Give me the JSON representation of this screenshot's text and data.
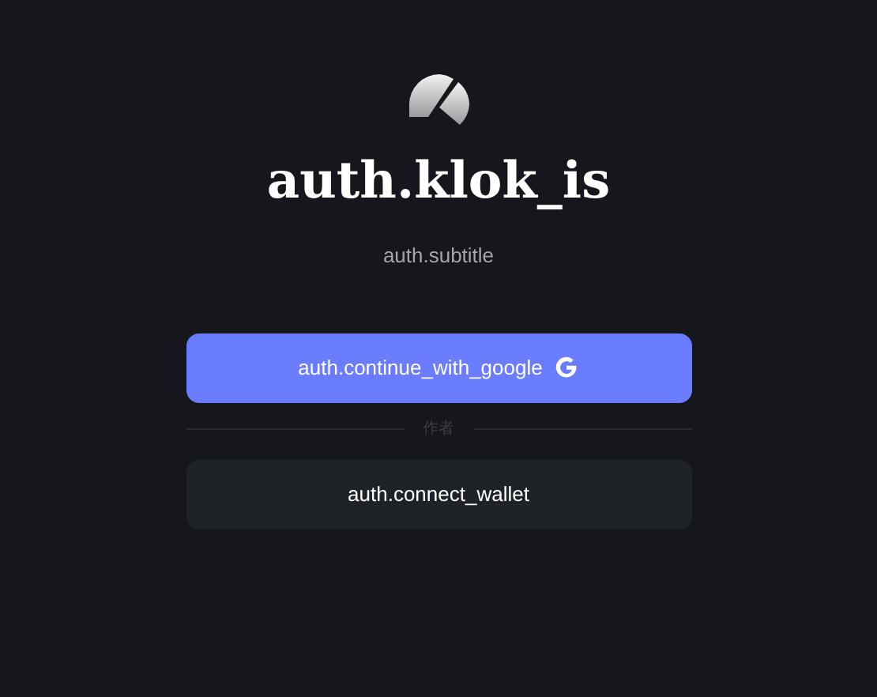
{
  "title": "auth.klok_is",
  "subtitle": "auth.subtitle",
  "google_button": {
    "label": "auth.continue_with_google"
  },
  "divider": "作者",
  "wallet_button": {
    "label": "auth.connect_wallet"
  }
}
